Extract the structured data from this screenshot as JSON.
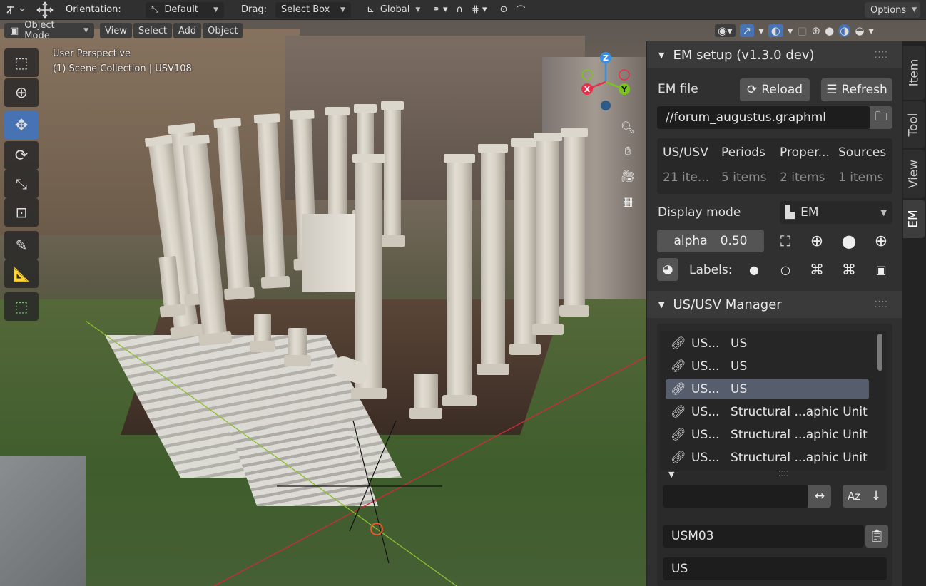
{
  "topbar": {
    "orientation_label": "Orientation:",
    "orientation_value": "Default",
    "drag_label": "Drag:",
    "drag_value": "Select Box",
    "transform_value": "Global",
    "options_label": "Options"
  },
  "header": {
    "mode": "Object Mode",
    "menus": [
      "View",
      "Select",
      "Add",
      "Object"
    ]
  },
  "viewport": {
    "perspective": "User Perspective",
    "collection": "(1) Scene Collection | USV108",
    "gizmo_axes": [
      "Z",
      "X",
      "Y"
    ]
  },
  "tabs": [
    "Item",
    "Tool",
    "View",
    "EM"
  ],
  "em_setup": {
    "title": "EM setup (v1.3.0 dev)",
    "em_file_label": "EM file",
    "reload_label": "Reload",
    "refresh_label": "Refresh",
    "file_path": "//forum_augustus.graphml",
    "columns": [
      {
        "title": "US/USV",
        "value": "21 ite..."
      },
      {
        "title": "Periods",
        "value": "5 items"
      },
      {
        "title": "Proper...",
        "value": "2 items"
      },
      {
        "title": "Sources",
        "value": "1 items"
      }
    ],
    "display_mode_label": "Display mode",
    "display_mode_value": "EM",
    "alpha_label": "alpha",
    "alpha_value": "0.50",
    "labels_label": "Labels:"
  },
  "us_manager": {
    "title": "US/USV Manager",
    "rows": [
      {
        "name": "US...",
        "type": "US",
        "selected": false
      },
      {
        "name": "US...",
        "type": "US",
        "selected": false
      },
      {
        "name": "US...",
        "type": "US",
        "selected": true
      },
      {
        "name": "US...",
        "type": "Structural ...aphic Unit",
        "selected": false
      },
      {
        "name": "US...",
        "type": "Structural ...aphic Unit",
        "selected": false
      },
      {
        "name": "US...",
        "type": "Structural ...aphic Unit",
        "selected": false
      }
    ],
    "filter_value": "",
    "selected_name": "USM03",
    "selected_type": "US"
  },
  "colors": {
    "accent": "#4772b3",
    "panel_bg": "#303030",
    "selected_row": "#565e6d",
    "axis_x": "#e8304a",
    "axis_y": "#7bc41f",
    "axis_z": "#3b8fe0"
  }
}
